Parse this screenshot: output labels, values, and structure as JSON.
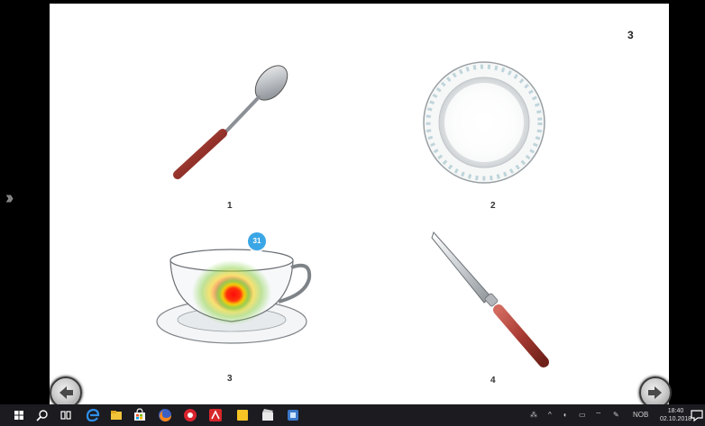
{
  "slide": {
    "page_number": "3",
    "items": [
      {
        "label": "1",
        "object": "spoon"
      },
      {
        "label": "2",
        "object": "plate"
      },
      {
        "label": "3",
        "object": "cup"
      },
      {
        "label": "4",
        "object": "knife"
      }
    ],
    "gaze_badge": "31"
  },
  "navigation": {
    "collapse_icon": "double-chevron-right-icon",
    "back_icon": "arrow-left-icon",
    "next_icon": "arrow-right-icon"
  },
  "taskbar": {
    "apps": [
      "windows-start-icon",
      "search-icon",
      "task-view-icon",
      "edge-icon",
      "file-explorer-icon",
      "store-icon",
      "firefox-icon",
      "app-icon",
      "acrobat-icon",
      "notes-icon",
      "movie-icon",
      "remote-icon"
    ],
    "language": "NOB",
    "time": "18:40",
    "date": "02.10.2018"
  },
  "colors": {
    "background": "#000000",
    "slide": "#ffffff",
    "handle": "#b8423a",
    "badge": "#3aa6e6",
    "taskbar": "#1b1b20"
  }
}
